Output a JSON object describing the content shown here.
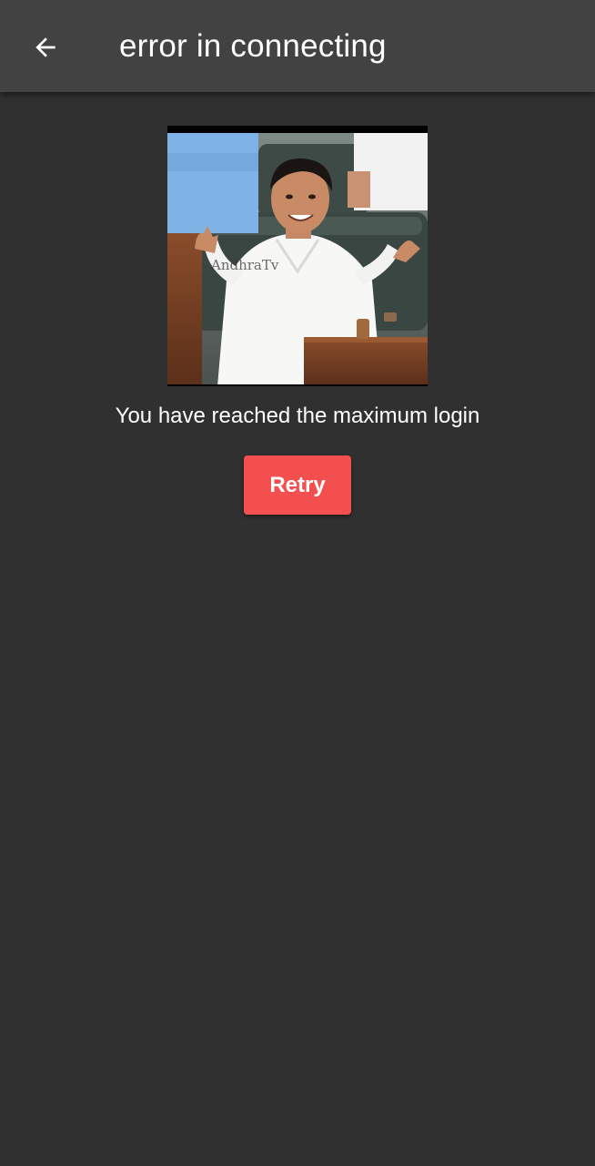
{
  "app_bar": {
    "title": "error in connecting",
    "back_icon": "arrow-back-icon"
  },
  "main": {
    "image": {
      "subject": "animated-meme-gif",
      "watermark": "AndhraTv"
    },
    "message": "You have reached the maximum login",
    "retry_label": "Retry"
  },
  "colors": {
    "app_bar": "#424242",
    "background": "#303030",
    "accent": "#f44f4f",
    "text": "#ffffff"
  }
}
